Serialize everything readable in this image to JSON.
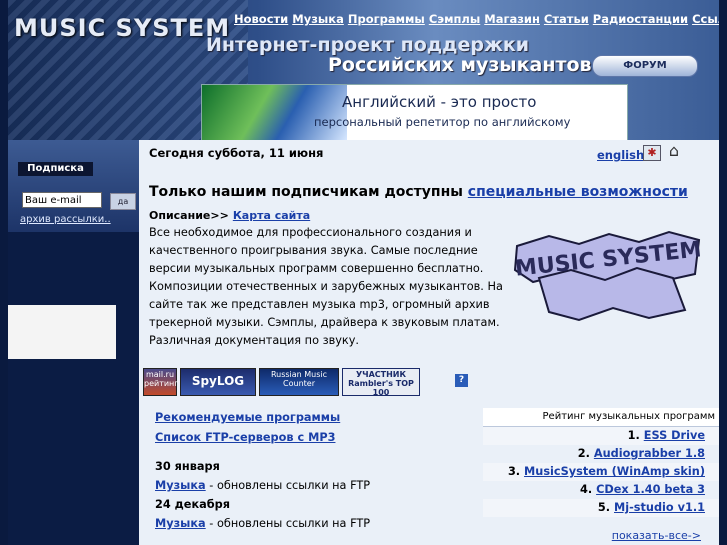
{
  "site": {
    "logo": "MUSIC SYSTEM",
    "nav": [
      "Новости",
      "Музыка",
      "Программы",
      "Сэмплы",
      "Магазин",
      "Статьи",
      "Радиостанции",
      "Ссылки"
    ],
    "slogan_line1": "Интернет-проект поддержки",
    "slogan_line2": "Российских музыкантов",
    "forum_label": "ФОРУМ"
  },
  "banner": {
    "line1": "Английский - это просто",
    "line2": "персональный репетитор по английскому"
  },
  "subscribe": {
    "title": "Подписка",
    "email_value": "Ваш e-mail",
    "go_label": "да",
    "archive_link": "архив рассылки.."
  },
  "main": {
    "date": "Сегодня суббота, 11 июня",
    "lang_link": "english",
    "headline_text": "Только нашим подписчикам доступны",
    "headline_link": "специальные возможности",
    "desc_label": "Описание>>",
    "sitemap_link": "Карта сайта",
    "paragraph": "Все необходимое для профессионального создания и качественного проигрывания звука. Самые последние версии музыкальных программ совершенно бесплатно.      Композиции отечественных и зарубежных музыкантов. На сайте так же представлен музыка mp3, огромный архив трекерной музыки. Сэмплы, драйвера к звуковым платам.                Различная документация по звуку.",
    "graffiti_text": "MUSIC SYSTEM"
  },
  "badges": [
    {
      "label": "mail.ru рейтинг"
    },
    {
      "label": "SpyLOG"
    },
    {
      "label": "Russian Music Counter"
    },
    {
      "label": "УЧАСТНИК Rambler's TOP 100"
    }
  ],
  "help_icon": "?",
  "links": [
    "Рекомендуемые программы",
    "Список FTP-серверов с MP3"
  ],
  "news": [
    {
      "date": "30 января",
      "link": "Музыка",
      "text": " - обновлены ссылки на FTP"
    },
    {
      "date": "24 декабря",
      "link": "Музыка",
      "text": " - обновлены ссылки на FTP"
    }
  ],
  "rating": {
    "title": "Рейтинг музыкальных программ",
    "items": [
      {
        "num": "1.",
        "name": "ESS Drive"
      },
      {
        "num": "2.",
        "name": "Audiograbber 1.8"
      },
      {
        "num": "3.",
        "name": "MusicSystem (WinAmp skin)"
      },
      {
        "num": "4.",
        "name": "CDex 1.40 beta 3"
      },
      {
        "num": "5.",
        "name": "Mj-studio v1.1"
      }
    ],
    "more": "показать-все->"
  },
  "colors": {
    "link": "#1a3fa8",
    "page_bg": "#0a1a3f",
    "content_bg": "#eaf0f8"
  }
}
